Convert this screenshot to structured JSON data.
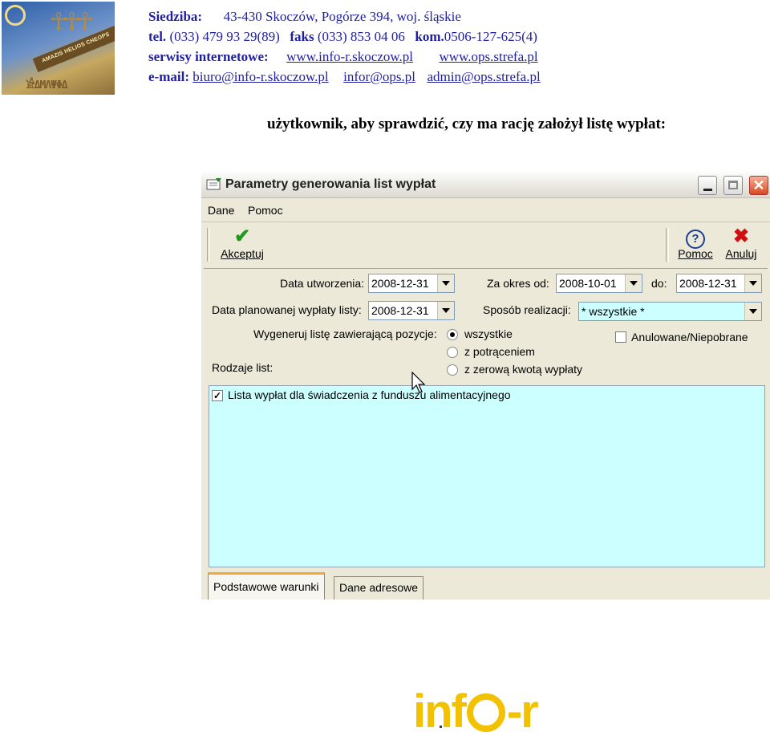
{
  "letterhead": {
    "logo_text": "AMAZIS HELIOS CHEOPS",
    "line1_label": "Siedziba:",
    "line1_value": "43-430 Skoczów,  Pogórze 394,  woj. śląskie",
    "line2_tel_label": "tel.",
    "line2_tel": "(033) 479 93 29(89)",
    "line2_fax_label": "faks",
    "line2_fax": "(033) 853 04 06",
    "line2_kom_label": "kom.",
    "line2_kom": "0506-127-625(4)",
    "line3_label": "serwisy internetowe:",
    "line3_site1": "www.info-r.skoczow.pl",
    "line3_site2": "www.ops.strefa.pl",
    "line4_label": "e-mail:",
    "line4_mail1": "biuro@info-r.skoczow.pl",
    "line4_mail2": "infor@ops.pl",
    "line4_mail3": "admin@ops.strefa.pl"
  },
  "caption": "użytkownik, aby sprawdzić, czy ma rację założył listę wypłat:",
  "dialog": {
    "title": "Parametry generowania list wypłat",
    "menu": [
      "Dane",
      "Pomoc"
    ],
    "toolbar": {
      "accept": "Akceptuj",
      "help": "Pomoc",
      "cancel": "Anuluj"
    },
    "form": {
      "created_label": "Data utworzenia:",
      "created_value": "2008-12-31",
      "period_from_label": "Za okres od:",
      "period_from_value": "2008-10-01",
      "period_to_label": "do:",
      "period_to_value": "2008-12-31",
      "planned_label": "Data planowanej wypłaty listy:",
      "planned_value": "2008-12-31",
      "method_label": "Sposób realizacji:",
      "method_value": "* wszystkie *",
      "generate_label": "Wygeneruj listę zawierającą pozycje:",
      "radio_all": "wszystkie",
      "radio_deduction": "z potrąceniem",
      "radio_zero": "z zerową kwotą wypłaty",
      "cancelled_label": "Anulowane/Niepobrane",
      "list_types_label": "Rodzaje list:"
    },
    "list_items": [
      {
        "label": "Lista wypłat dla świadczenia z funduszu alimentacyjnego",
        "checked": true
      }
    ],
    "tabs": [
      "Podstawowe warunki",
      "Dane adresowe"
    ]
  },
  "footer_logo": {
    "left": "inf",
    "right": "-r"
  },
  "colors": {
    "header_text": "#1f1fa0",
    "list_bg": "#ccffff",
    "logo_yellow": "#f2c200",
    "dialog_bg": "#ece9d8"
  }
}
